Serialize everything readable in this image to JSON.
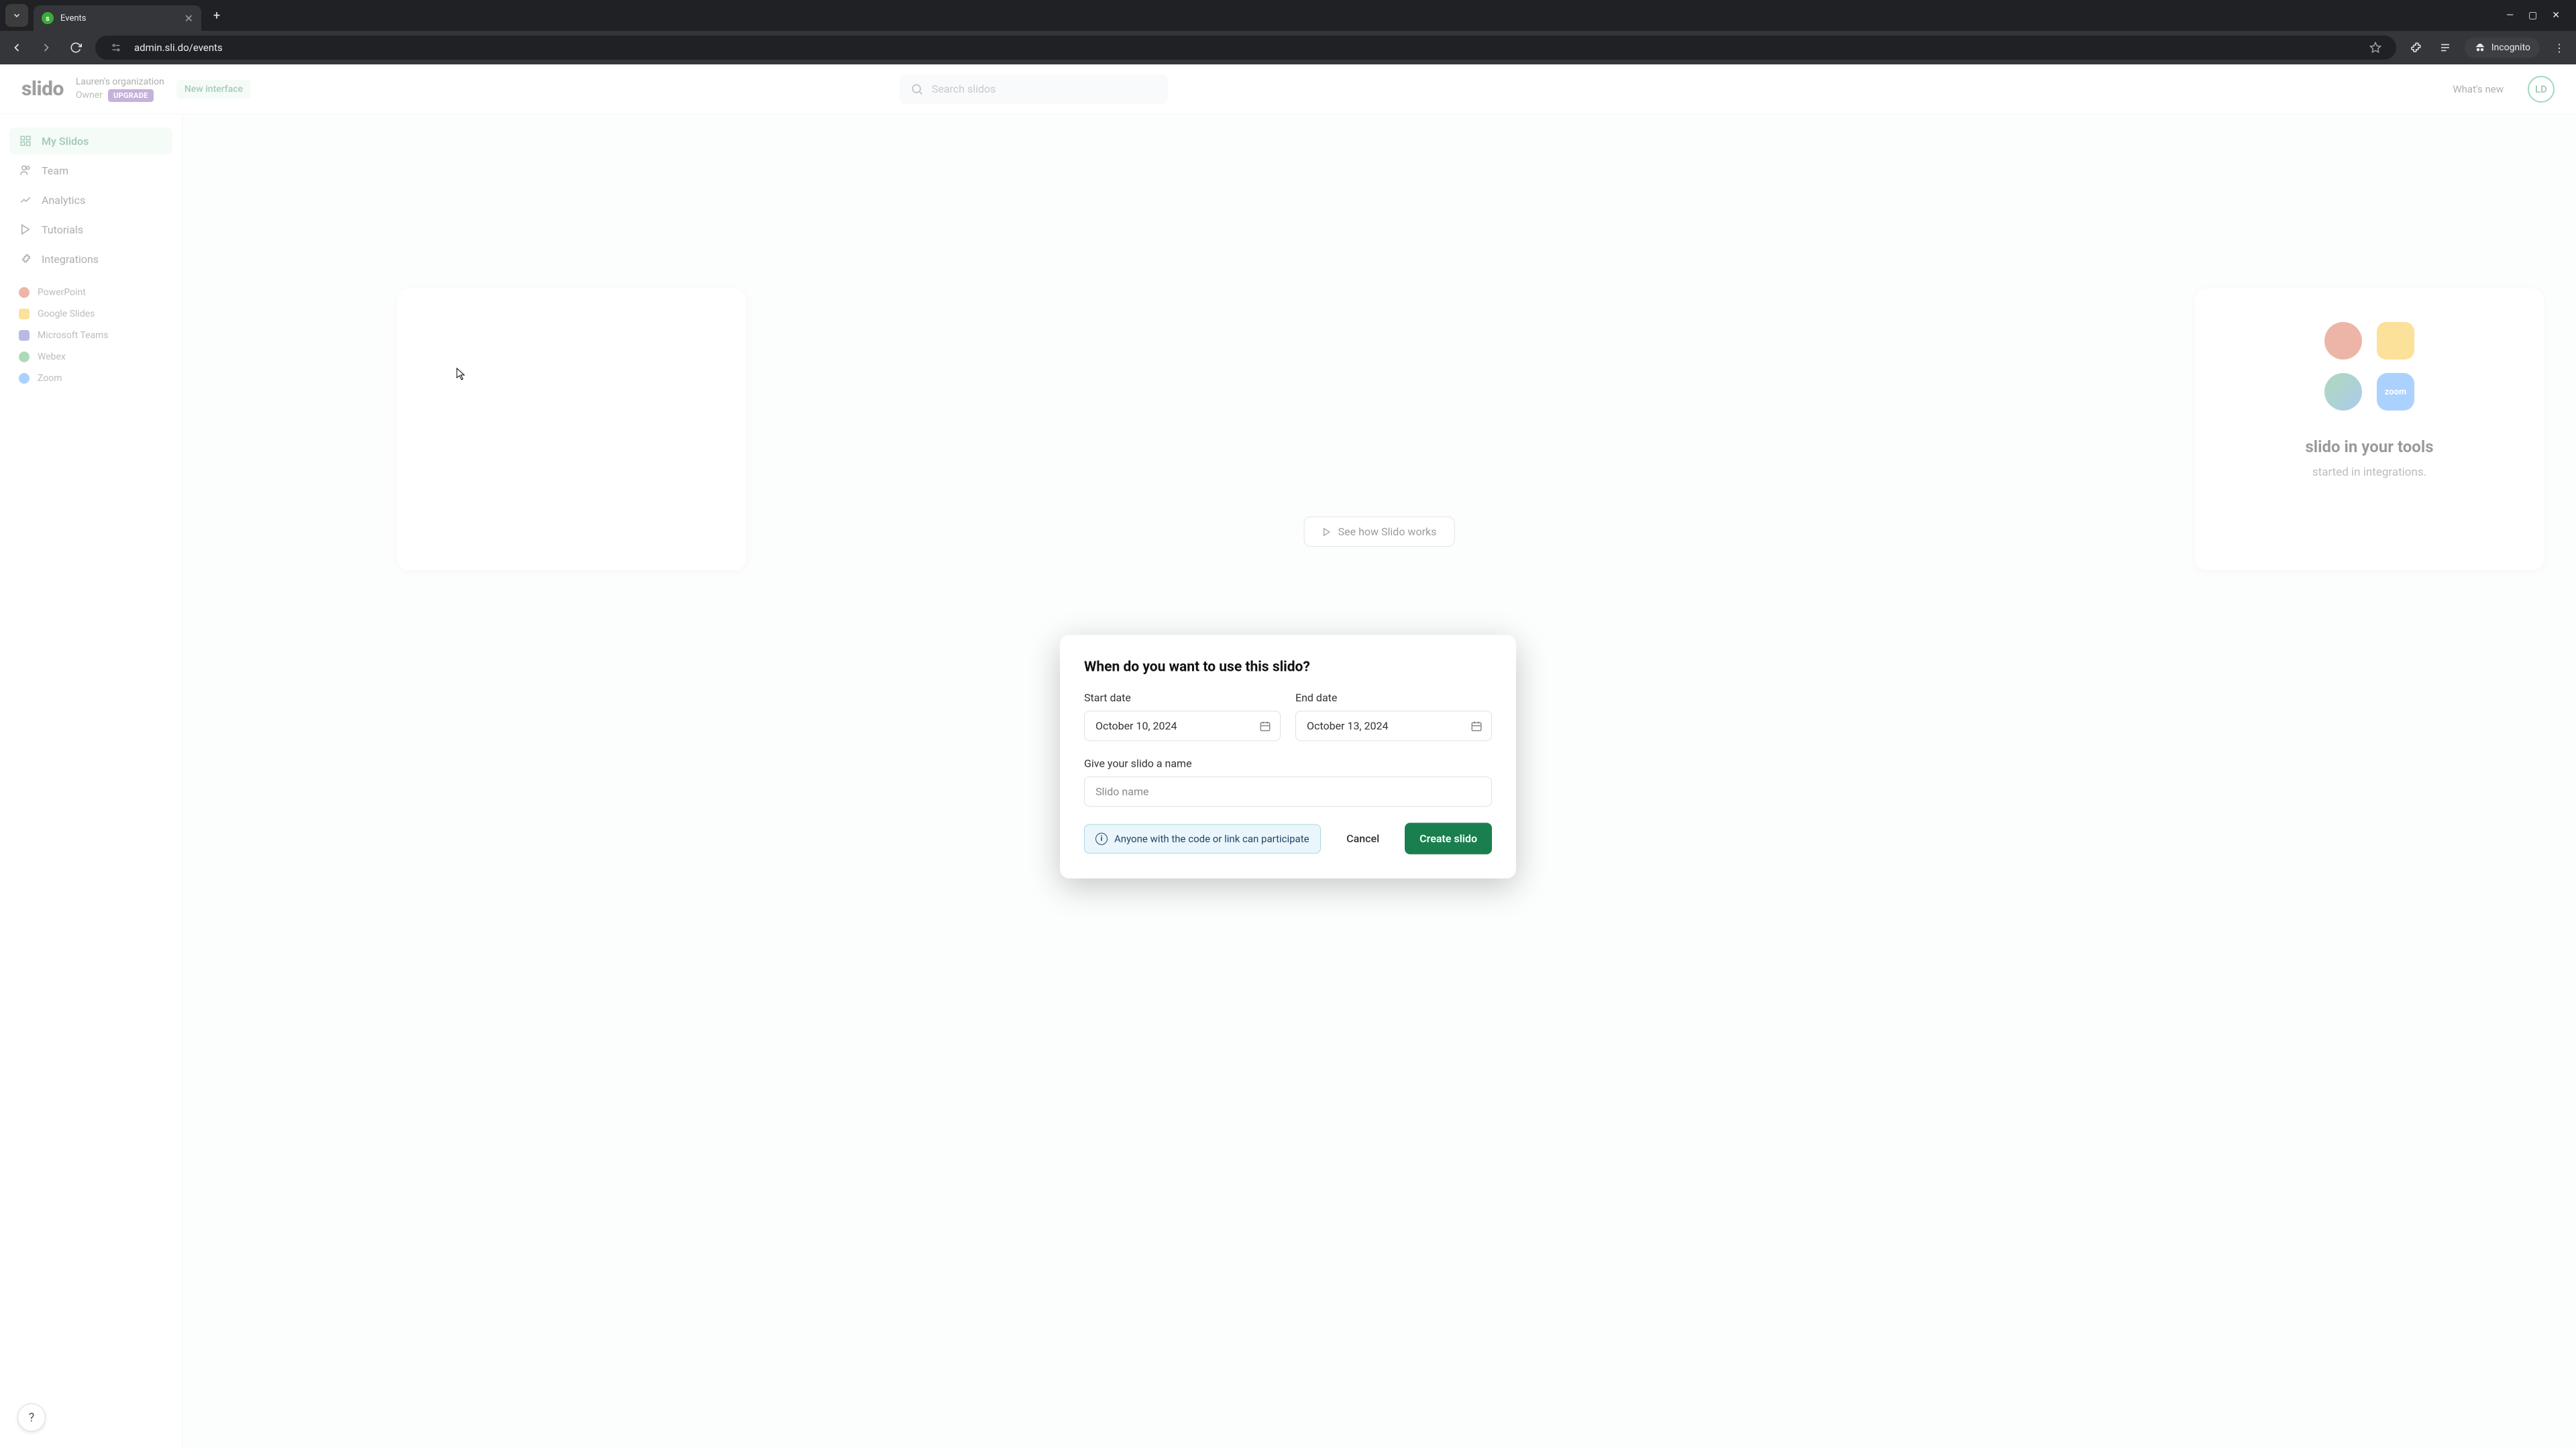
{
  "browser": {
    "tab_title": "Events",
    "tab_favicon_letter": "s",
    "url": "admin.sli.do/events",
    "incognito_label": "Incognito"
  },
  "header": {
    "logo_text": "slido",
    "org_name": "Lauren's organization",
    "role": "Owner",
    "upgrade": "UPGRADE",
    "new_interface": "New interface",
    "search_placeholder": "Search slidos",
    "whats_new": "What's new",
    "avatar_initials": "LD"
  },
  "sidebar": {
    "items": [
      {
        "label": "My Slidos",
        "active": true
      },
      {
        "label": "Team"
      },
      {
        "label": "Analytics"
      },
      {
        "label": "Tutorials"
      },
      {
        "label": "Integrations"
      }
    ],
    "integrations": [
      {
        "label": "PowerPoint"
      },
      {
        "label": "Google Slides"
      },
      {
        "label": "Microsoft Teams"
      },
      {
        "label": "Webex"
      },
      {
        "label": "Zoom"
      }
    ]
  },
  "background": {
    "tools_title": "slido in your tools",
    "tools_sub": "started in integrations.",
    "see_how": "See how Slido works",
    "zoom_label": "zoom"
  },
  "modal": {
    "title": "When do you want to use this slido?",
    "start_label": "Start date",
    "start_value": "October 10, 2024",
    "end_label": "End date",
    "end_value": "October 13, 2024",
    "name_label": "Give your slido a name",
    "name_placeholder": "Slido name",
    "info_text": "Anyone with the code or link can participate",
    "cancel": "Cancel",
    "create": "Create slido"
  },
  "help": "?"
}
